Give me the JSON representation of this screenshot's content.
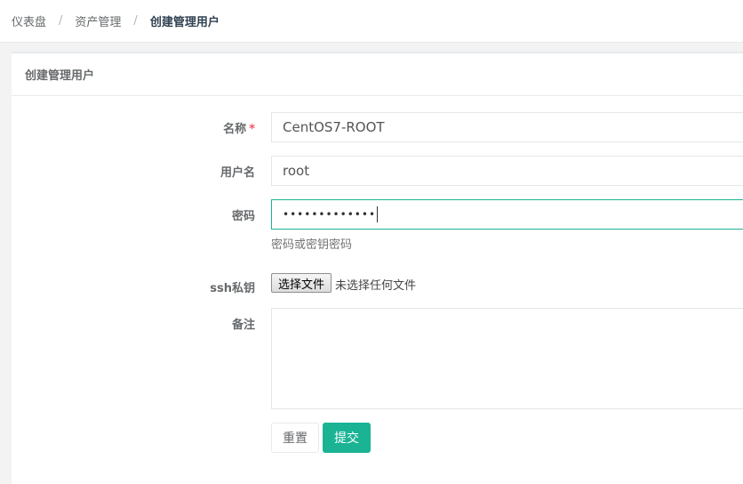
{
  "breadcrumb": {
    "items": [
      "仪表盘",
      "资产管理",
      "创建管理用户"
    ],
    "separator": "/"
  },
  "panel": {
    "title": "创建管理用户"
  },
  "form": {
    "name": {
      "label": "名称",
      "required_mark": "*",
      "value": "CentOS7-ROOT"
    },
    "username": {
      "label": "用户名",
      "value": "root"
    },
    "password": {
      "label": "密码",
      "masked_value": "•••••••••••••",
      "help": "密码或密钥密码"
    },
    "ssh_key": {
      "label": "ssh私钥",
      "button_label": "选择文件",
      "status": "未选择任何文件"
    },
    "comment": {
      "label": "备注",
      "value": ""
    },
    "buttons": {
      "reset": "重置",
      "submit": "提交"
    }
  },
  "colors": {
    "accent": "#1ab394",
    "required": "#ed5565",
    "background": "#f3f3f4"
  }
}
